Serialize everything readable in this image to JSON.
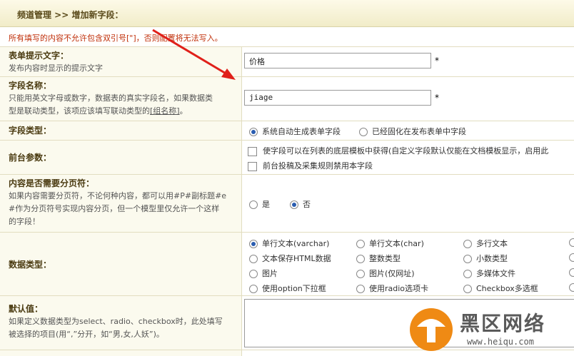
{
  "header": {
    "breadcrumb": "频道管理 >> 增加新字段："
  },
  "notice": "所有填写的内容不允许包含双引号[\"]，否则配置将无法写入。",
  "fields": {
    "form_hint": {
      "label": "表单提示文字：",
      "desc": "发布内容时显示的提示文字",
      "value": "价格",
      "required": "*"
    },
    "field_name": {
      "label": "字段名称：",
      "desc1": "只能用英文字母或数字，数据表的真实字段名，如果数据类",
      "desc2": "型是联动类型，该项应该填写联动类型的",
      "desc2_link": "[组名称]",
      "desc2_end": "。",
      "value": "jiage",
      "required": "*"
    },
    "field_type": {
      "label": "字段类型：",
      "options": [
        "系统自动生成表单字段",
        "已经固化在发布表单中字段"
      ]
    },
    "frontend": {
      "label": "前台参数：",
      "options": [
        "使字段可以在列表的底层模板中获得(自定义字段默认仅能在文档模板显示，启用此",
        "前台投稿及采集规则禁用本字段"
      ]
    },
    "paging": {
      "label": "内容是否需要分页符：",
      "desc1": "如果内容需要分页符，不论何种内容，都可以用#P#副标题#e",
      "desc2": "#作为分页符号实现内容分页，但一个模型里仅允许一个这样",
      "desc3": "的字段！",
      "options": [
        "是",
        "否"
      ]
    },
    "data_type": {
      "label": "数据类型：",
      "options": [
        "单行文本(varchar)",
        "单行文本(char)",
        "多行文本",
        "文本保存HTML数据",
        "整数类型",
        "小数类型",
        "图片",
        "图片(仅网址)",
        "多媒体文件",
        "使用option下拉框",
        "使用radio选项卡",
        "Checkbox多选框"
      ]
    },
    "default_value": {
      "label": "默认值：",
      "desc1": "如果定义数据类型为select、radio、checkbox时，此处填写",
      "desc2": "被选择的项目(用“,”分开，如“男,女,人妖”)。"
    }
  },
  "watermark": {
    "text": "黑区网络",
    "url": "www.heiqu.com"
  },
  "colors": {
    "header_bg": "#f1ecc8",
    "notice": "#c0300b",
    "label": "#4a3a10",
    "arrow": "#e0201a"
  }
}
